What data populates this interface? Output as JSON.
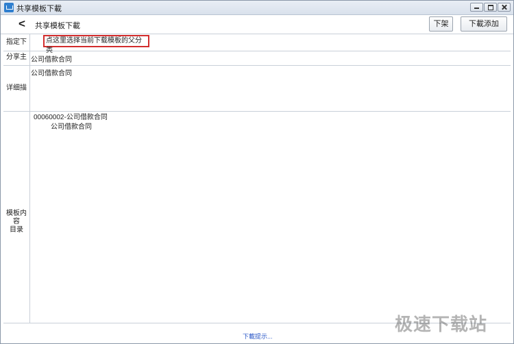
{
  "window": {
    "title": "共享模板下載"
  },
  "toolbar": {
    "back_label": "<",
    "page_title": "共享模板下載",
    "unshelve_label": "下架",
    "download_add_label": "下載添加"
  },
  "form": {
    "download_dir": {
      "label": "指定下載目录",
      "value": "点这里选择当前下载模板的父分类"
    },
    "share_subject": {
      "label": "分享主题",
      "value": "公司借款合同"
    },
    "description": {
      "label": "详细描述",
      "value": "公司借款合同"
    },
    "contents": {
      "label_line1": "模板内容",
      "label_line2": "目录",
      "tree": [
        {
          "text": "00060002-公司借款合同",
          "children": [
            "公司借款合同"
          ]
        }
      ]
    }
  },
  "status": {
    "hint": "下載提示..."
  },
  "watermark": "极速下载站",
  "colors": {
    "highlight_border": "#d22c2c",
    "status_link": "#2a57c7"
  },
  "icons": {
    "app": "app-logo-icon",
    "minimize": "minimize-icon",
    "maximize": "maximize-icon",
    "close": "close-icon",
    "back": "chevron-left-icon"
  }
}
